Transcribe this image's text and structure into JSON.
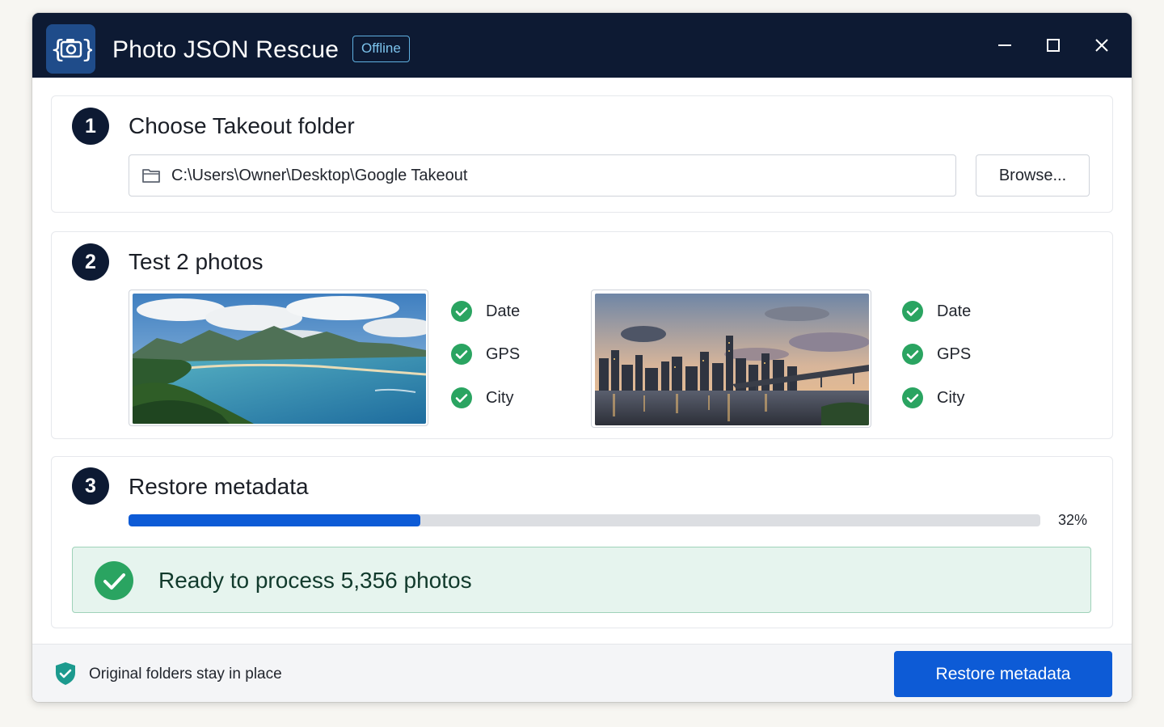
{
  "app": {
    "title": "Photo JSON Rescue",
    "status_badge": "Offline",
    "icon": "camera-braces-icon"
  },
  "window_controls": [
    "minimize-icon",
    "maximize-icon",
    "close-icon"
  ],
  "step1": {
    "number": "1",
    "title": "Choose Takeout folder",
    "folder_path": "C:\\Users\\Owner\\Desktop\\Google Takeout",
    "browse_label": "Browse..."
  },
  "step2": {
    "number": "2",
    "title": "Test 2 photos",
    "photos": [
      {
        "subject": "coastal-landscape",
        "checks": [
          "Date",
          "GPS",
          "City"
        ]
      },
      {
        "subject": "city-skyline-at-dusk",
        "checks": [
          "Date",
          "GPS",
          "City"
        ]
      }
    ]
  },
  "step3": {
    "number": "3",
    "title": "Restore metadata",
    "progress": 0.32,
    "progress_label": "32%",
    "ready_message": "Ready to process 5,356 photos"
  },
  "footer": {
    "note": "Original folders stay in place",
    "restore_button": "Restore metadata"
  },
  "colors": {
    "titlebar": "#0d1a33",
    "accent": "#0d5bd6",
    "success": "#2aa461",
    "ready_bg": "#e6f4ee"
  }
}
